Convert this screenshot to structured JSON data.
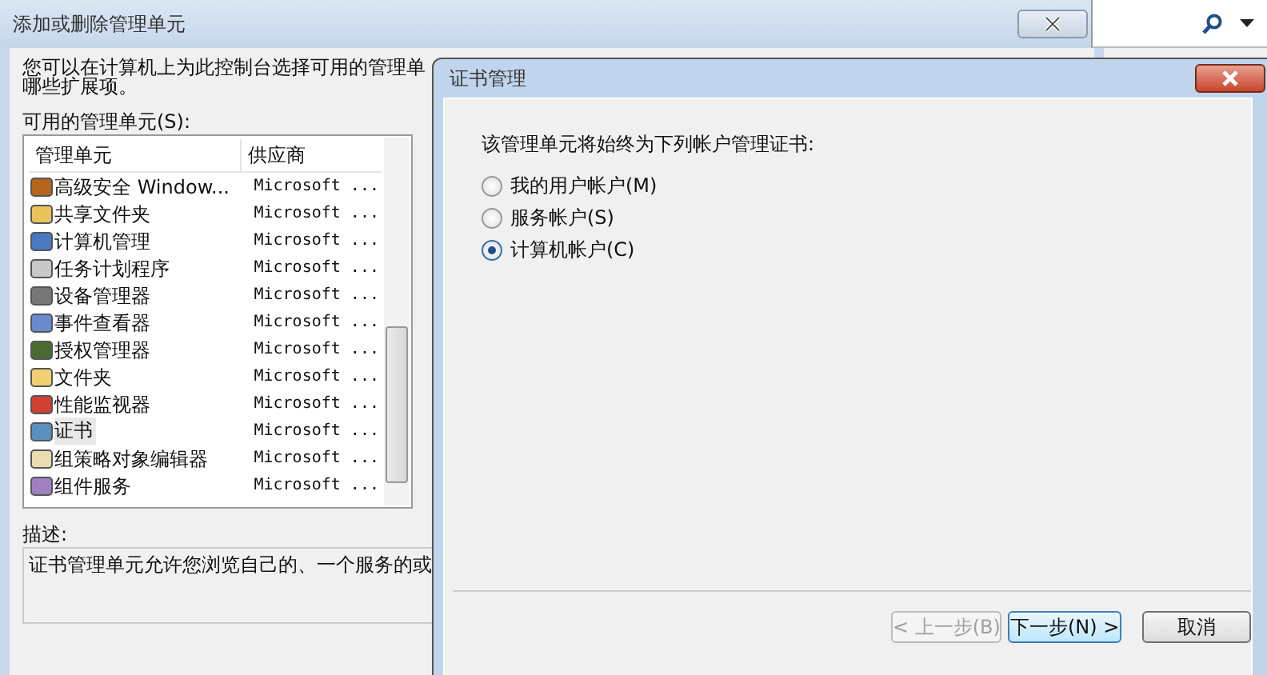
{
  "back_dialog": {
    "title": "添加或删除管理单元",
    "intro_lines": [
      "您可以在计算机上为此控制台选择可用的管理单",
      "哪些扩展项。"
    ],
    "available_label": "可用的管理单元(S):",
    "columns": [
      "管理单元",
      "供应商"
    ],
    "rows": [
      {
        "name": "高级安全 Window...",
        "vendor": "Microsoft ...",
        "selected": false
      },
      {
        "name": "共享文件夹",
        "vendor": "Microsoft ...",
        "selected": false
      },
      {
        "name": "计算机管理",
        "vendor": "Microsoft ...",
        "selected": false
      },
      {
        "name": "任务计划程序",
        "vendor": "Microsoft ...",
        "selected": false
      },
      {
        "name": "设备管理器",
        "vendor": "Microsoft ...",
        "selected": false
      },
      {
        "name": "事件查看器",
        "vendor": "Microsoft ...",
        "selected": false
      },
      {
        "name": "授权管理器",
        "vendor": "Microsoft ...",
        "selected": false
      },
      {
        "name": "文件夹",
        "vendor": "Microsoft ...",
        "selected": false
      },
      {
        "name": "性能监视器",
        "vendor": "Microsoft ...",
        "selected": false
      },
      {
        "name": "证书",
        "vendor": "Microsoft ...",
        "selected": true
      },
      {
        "name": "组策略对象编辑器",
        "vendor": "Microsoft ...",
        "selected": false
      },
      {
        "name": "组件服务",
        "vendor": "Microsoft ...",
        "selected": false
      }
    ],
    "description_label": "描述:",
    "description": "证书管理单元允许您浏览自己的、一个服务的或"
  },
  "front_dialog": {
    "title": "证书管理",
    "prompt": "该管理单元将始终为下列帐户管理证书:",
    "options": [
      {
        "label": "我的用户帐户(M)",
        "selected": false
      },
      {
        "label": "服务帐户(S)",
        "selected": false
      },
      {
        "label": "计算机帐户(C)",
        "selected": true
      }
    ],
    "buttons": [
      {
        "label": "< 上一步(B)",
        "disabled": true,
        "focused": false
      },
      {
        "label": "下一步(N) >",
        "disabled": false,
        "focused": true
      },
      {
        "label": "取消",
        "disabled": false,
        "focused": false
      }
    ]
  }
}
